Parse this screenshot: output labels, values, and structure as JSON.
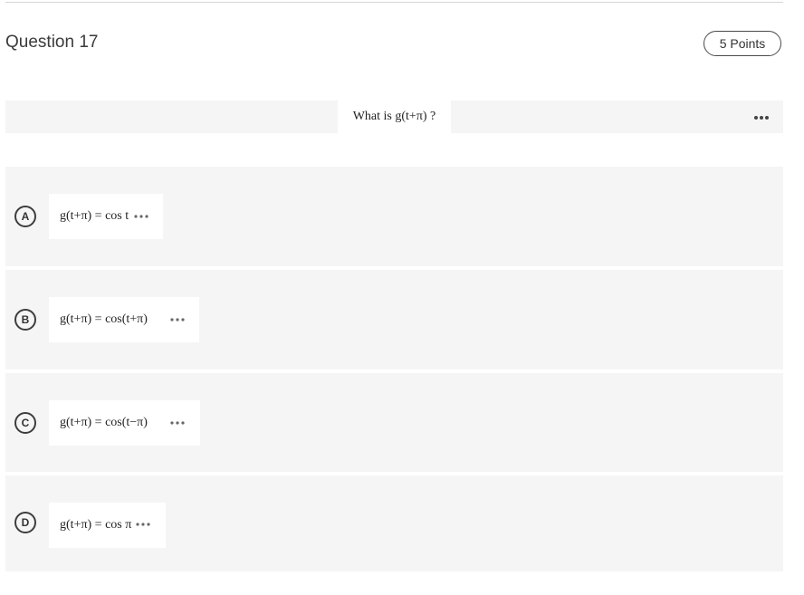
{
  "question": {
    "title": "Question 17",
    "points": "5 Points",
    "prompt": "What is g(t+π) ?"
  },
  "icons": {
    "more": "more-horizontal-icon",
    "option_dots": "equation-ellipsis-icon"
  },
  "options": [
    {
      "letter": "A",
      "equation": "g(t+π) = cos t"
    },
    {
      "letter": "B",
      "equation": "g(t+π) = cos(t+π)"
    },
    {
      "letter": "C",
      "equation": "g(t+π) = cos(t−π)"
    },
    {
      "letter": "D",
      "equation": "g(t+π) = cos π"
    }
  ]
}
